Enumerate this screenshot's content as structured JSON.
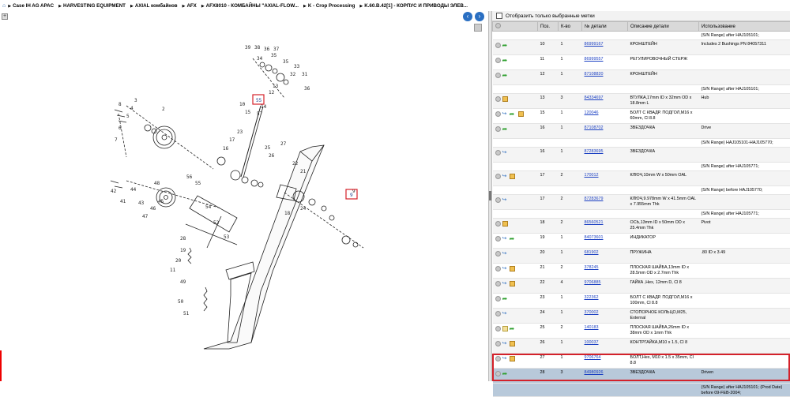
{
  "breadcrumb": {
    "items": [
      "Case IH AG APAC",
      "HARVESTING EQUIPMENT",
      "AXIAL комбайнов",
      "AFX",
      "AFX8010 - КОМБАЙНЫ \"AXIAL-FLOW...",
      "K - Crop Processing",
      "K.60.B.42[1] - КОРПУС И ПРИВОДЫ ЭЛЕВ..."
    ]
  },
  "diagram": {
    "zoom_label": "+",
    "prev_label": "‹",
    "next_label": "›",
    "callouts": [
      "39",
      "38",
      "36",
      "37",
      "34",
      "35",
      "35",
      "33",
      "32",
      "31",
      "10",
      "15",
      "57",
      "14",
      "13",
      "12",
      "36",
      "2",
      "3",
      "4",
      "5",
      "6",
      "7",
      "8",
      "42",
      "41",
      "44",
      "43",
      "47",
      "46",
      "45",
      "48",
      "25",
      "26",
      "27",
      "23",
      "17",
      "16",
      "22",
      "21",
      "18",
      "28",
      "19",
      "20",
      "11",
      "49",
      "50",
      "51",
      "52",
      "53",
      "54",
      "55",
      "56",
      "9",
      "24"
    ],
    "highlight_1": "55",
    "highlight_2": "9"
  },
  "parts": {
    "filter_label": "Отобразить только выбранные метки",
    "columns": [
      "",
      "Поз.",
      "К-во",
      "№ детали",
      "Описание детали",
      "Использование"
    ],
    "rows": [
      {
        "type": "note",
        "text": "(S/N Range) after HAJ105101;"
      },
      {
        "type": "row",
        "pos": "10",
        "qty": "1",
        "part": "86999167",
        "desc": "КРОНШТЕЙН",
        "usage": "Includes 2 Bushings PN 84057311",
        "icons": [
          "c",
          "a"
        ]
      },
      {
        "type": "row",
        "pos": "11",
        "qty": "1",
        "part": "86999557",
        "desc": "РЕГУЛИРОВОЧНЫЙ СТЕРЖ",
        "usage": "",
        "icons": [
          "c",
          "a"
        ]
      },
      {
        "type": "row",
        "pos": "12",
        "qty": "1",
        "part": "87108820",
        "desc": "КРОНШТЕЙН",
        "usage": "",
        "icons": [
          "c",
          "a"
        ]
      },
      {
        "type": "note",
        "text": "(S/N Range) after HAJ105101;"
      },
      {
        "type": "row",
        "pos": "13",
        "qty": "3",
        "part": "84334697",
        "desc": "ВТУЛКА,17mm ID x 32mm OD x 18.8mm L",
        "usage": "Hub",
        "icons": [
          "c",
          "k"
        ]
      },
      {
        "type": "row",
        "pos": "15",
        "qty": "1",
        "part": "120046",
        "desc": "БОЛТ С КВАДР. ПОДГОЛ,M16 x 60mm, Cl 8.8",
        "usage": "",
        "icons": [
          "c",
          "b",
          "a",
          "k"
        ]
      },
      {
        "type": "row",
        "pos": "16",
        "qty": "1",
        "part": "87108702",
        "desc": "ЗВЕЗДОЧКА",
        "usage": "Drive",
        "icons": [
          "c",
          "a"
        ]
      },
      {
        "type": "note",
        "text": "(S/N Range) HAJ105101-HAJ105770;"
      },
      {
        "type": "row",
        "pos": "16",
        "qty": "1",
        "part": "87283695",
        "desc": "ЗВЕЗДОЧКА",
        "usage": "",
        "icons": [
          "c",
          "b"
        ]
      },
      {
        "type": "note",
        "text": "(S/N Range) after HAJ105771;"
      },
      {
        "type": "row",
        "pos": "17",
        "qty": "2",
        "part": "170012",
        "desc": "КЛЮЧ,10mm W x 50mm OAL",
        "usage": "",
        "icons": [
          "c",
          "b",
          "k"
        ]
      },
      {
        "type": "note",
        "text": "(S/N Range) before HAJ105770;"
      },
      {
        "type": "row",
        "pos": "17",
        "qty": "2",
        "part": "87283679",
        "desc": "КЛЮЧ,9.978mm W x 41.5mm OAL x 7.955mm Thk",
        "usage": "",
        "icons": [
          "c",
          "b"
        ]
      },
      {
        "type": "note",
        "text": "(S/N Range) after HAJ105771;"
      },
      {
        "type": "row",
        "pos": "18",
        "qty": "2",
        "part": "86560521",
        "desc": "ОСЬ,13mm ID x 50mm OD x 25.4mm Thk",
        "usage": "Pivot",
        "icons": [
          "c",
          "k"
        ]
      },
      {
        "type": "row",
        "pos": "19",
        "qty": "1",
        "part": "84073601",
        "desc": "ИНДИКАТОР",
        "usage": "",
        "icons": [
          "c",
          "b",
          "a"
        ]
      },
      {
        "type": "row",
        "pos": "20",
        "qty": "1",
        "part": "681902",
        "desc": "ПРУЖИНА",
        "usage": ".80 ID x 3.49",
        "icons": [
          "c",
          "b"
        ]
      },
      {
        "type": "row",
        "pos": "21",
        "qty": "2",
        "part": "378245",
        "desc": "ПЛОСКАЯ ШАЙБА,13mm ID x 28.5mm OD x 2.7mm Thk",
        "usage": "",
        "icons": [
          "c",
          "b",
          "k"
        ]
      },
      {
        "type": "row",
        "pos": "22",
        "qty": "4",
        "part": "9706885",
        "desc": "ГАЙКА ,Hex, 12mm D, Cl 8",
        "usage": "",
        "icons": [
          "c",
          "b",
          "k"
        ]
      },
      {
        "type": "row",
        "pos": "23",
        "qty": "1",
        "part": "322362",
        "desc": "БОЛТ С КВАДР. ПОДГОЛ,M16 x 100mm, Cl 8.8",
        "usage": "",
        "icons": [
          "c",
          "a"
        ]
      },
      {
        "type": "row",
        "pos": "24",
        "qty": "1",
        "part": "370002",
        "desc": "СТОПОРНОЕ КОЛЬЦО,M25, External",
        "usage": "",
        "icons": [
          "c",
          "b"
        ]
      },
      {
        "type": "row",
        "pos": "25",
        "qty": "2",
        "part": "140183",
        "desc": "ПЛОСКАЯ ШАЙБА,26mm ID x 38mm OD x 1mm Thk",
        "usage": "",
        "icons": [
          "c",
          "x",
          "a"
        ]
      },
      {
        "type": "row",
        "pos": "26",
        "qty": "1",
        "part": "100037",
        "desc": "КОНТРГАЙКА,M10 x 1.5, Cl 8",
        "usage": "",
        "icons": [
          "c",
          "b",
          "k"
        ]
      },
      {
        "type": "row",
        "pos": "27",
        "qty": "1",
        "part": "9706764",
        "desc": "БОЛТ,Hex, M10 x 1.5 x 35mm, Cl 8.8",
        "usage": "",
        "icons": [
          "c",
          "b",
          "k"
        ]
      },
      {
        "type": "row",
        "pos": "28",
        "qty": "3",
        "part": "84980926",
        "desc": "ЗВЕЗДОЧКА",
        "usage": "Driven",
        "icons": [
          "c",
          "a"
        ],
        "selected": true
      },
      {
        "type": "note",
        "text": "(S/N Range) after HAJ105101; (Prod Date) before 09-FEB-2004;",
        "selected": true
      }
    ]
  }
}
